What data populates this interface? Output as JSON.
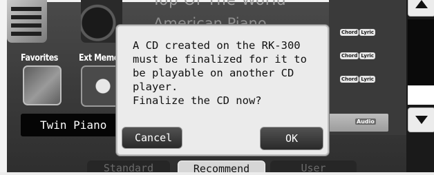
{
  "background": {
    "title_partial": "Top Of The World",
    "subtitle_partial": "American Piano"
  },
  "home_icons": {
    "favorites_label": "Favorites",
    "ext_memory_label": "Ext Memo"
  },
  "song_list": {
    "rows": [
      {
        "tags": [
          "Chord",
          "Lyric"
        ]
      },
      {
        "tags": [
          "Chord",
          "Lyric"
        ]
      },
      {
        "tags": [
          "Chord",
          "Lyric"
        ]
      }
    ],
    "audio_tag": "Audio"
  },
  "tone": {
    "name": "Twin Piano"
  },
  "tabs": [
    {
      "label": "Standard",
      "state": "inactive"
    },
    {
      "label": "Recommend",
      "state": "active"
    },
    {
      "label": "User",
      "state": "inactive"
    }
  ],
  "dialog": {
    "message_lines": [
      "A CD created on the RK-300",
      "must be finalized for it to",
      "be playable on another CD",
      "player.",
      "Finalize the CD now?"
    ],
    "cancel_label": "Cancel",
    "ok_label": "OK"
  },
  "icons": {
    "scroll_up": "triangle-up-icon",
    "scroll_down": "triangle-down-icon"
  },
  "colors": {
    "dialog_bg": "#ebebeb",
    "button_bg": "#3a3a3a",
    "active_tab": "#d6d6d6"
  }
}
